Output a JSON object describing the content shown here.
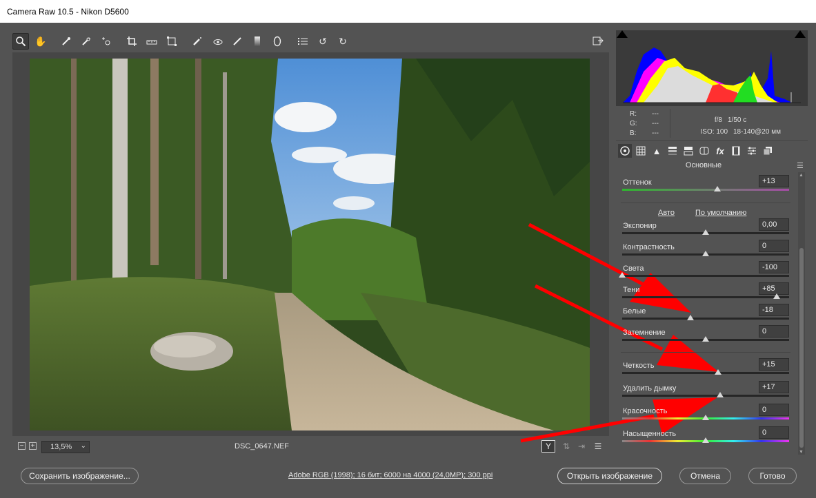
{
  "window": {
    "title": "Camera Raw 10.5  -  Nikon D5600"
  },
  "toolbar": {
    "tools": [
      "zoom-icon",
      "hand-icon",
      "white-balance-icon",
      "color-sampler-icon",
      "target-adjust-icon",
      "crop-icon",
      "straighten-icon",
      "transform-icon",
      "spot-removal-icon",
      "red-eye-icon",
      "adjustment-brush-icon",
      "graduated-filter-icon",
      "radial-filter-icon",
      "preferences-icon",
      "rotate-left-icon",
      "rotate-right-icon"
    ],
    "export_icon": "open-in-new-icon"
  },
  "status": {
    "zoom": "13,5%",
    "filename": "DSC_0647.NEF"
  },
  "info": {
    "r_label": "R:",
    "r_value": "---",
    "g_label": "G:",
    "g_value": "---",
    "b_label": "B:",
    "b_value": "---",
    "aperture": "f/8",
    "shutter": "1/50 с",
    "iso": "ISO: 100",
    "lens": "18-140@20 мм"
  },
  "panel": {
    "section_title": "Основные",
    "auto_link": "Авто",
    "default_link": "По умолчанию",
    "sliders": [
      {
        "label": "Оттенок",
        "value": "+13",
        "pos": 0.57,
        "gradient": "tint"
      },
      {
        "label": "Экспонир",
        "value": "0,00",
        "pos": 0.5
      },
      {
        "label": "Контрастность",
        "value": "0",
        "pos": 0.5
      },
      {
        "label": "Света",
        "value": "-100",
        "pos": 0.0
      },
      {
        "label": "Тени",
        "value": "+85",
        "pos": 0.925
      },
      {
        "label": "Белые",
        "value": "-18",
        "pos": 0.41
      },
      {
        "label": "Затемнение",
        "value": "0",
        "pos": 0.5
      },
      {
        "label": "Четкость",
        "value": "+15",
        "pos": 0.575
      },
      {
        "label": "Удалить дымку",
        "value": "+17",
        "pos": 0.585
      },
      {
        "label": "Красочность",
        "value": "0",
        "pos": 0.5,
        "gradient": "vibrance"
      },
      {
        "label": "Насыщенность",
        "value": "0",
        "pos": 0.5,
        "gradient": "saturation"
      }
    ]
  },
  "footer": {
    "save_label": "Сохранить изображение...",
    "workflow_link": "Adobe RGB (1998); 16 бит; 6000 на 4000 (24,0MP); 300 ppi",
    "open_label": "Открыть изображение",
    "cancel_label": "Отмена",
    "done_label": "Готово"
  },
  "colors": {
    "background": "#535353",
    "arrow": "#ff0000"
  }
}
